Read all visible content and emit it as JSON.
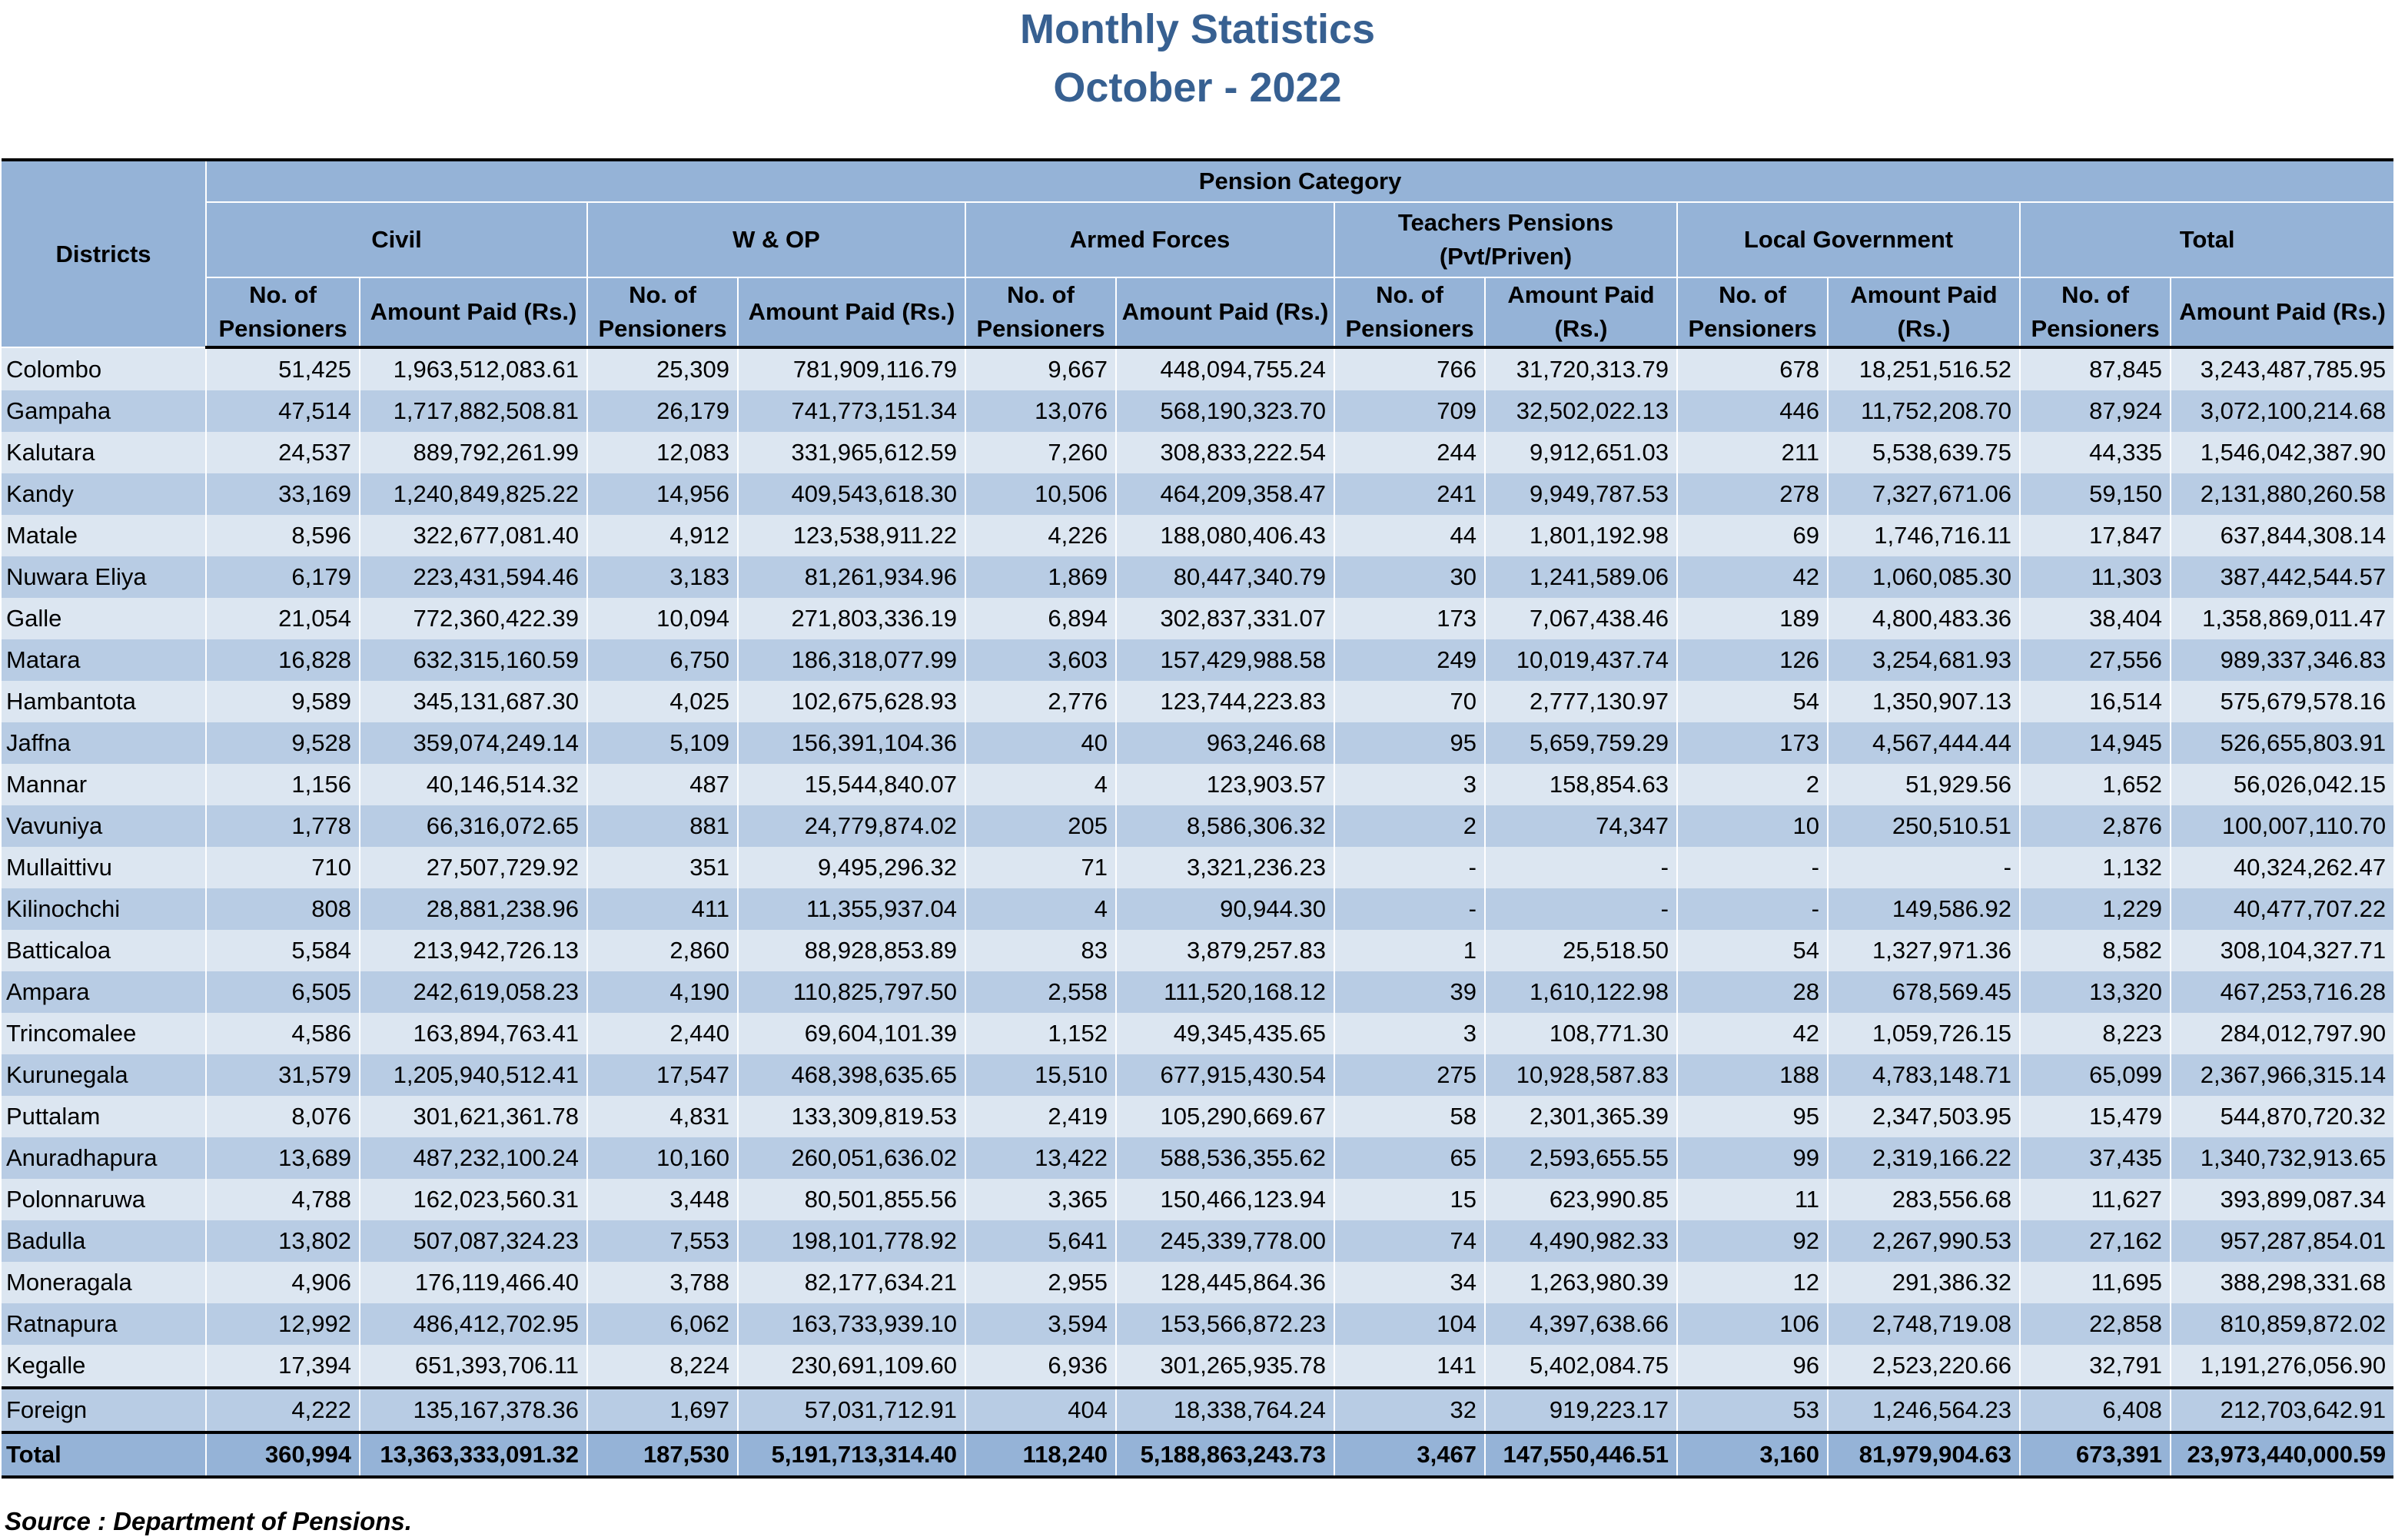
{
  "title": "Monthly Statistics",
  "subtitle": "October - 2022",
  "header": {
    "districts": "Districts",
    "pension_category": "Pension Category",
    "categories": [
      {
        "label": "Civil"
      },
      {
        "label": "W & OP"
      },
      {
        "label": "Armed Forces"
      },
      {
        "label": "Teachers Pensions (Pvt/Priven)"
      },
      {
        "label": "Local Government"
      },
      {
        "label": "Total"
      }
    ],
    "subcols": [
      "No. of Pensioners",
      "Amount Paid   (Rs.)",
      "No. of Pensioners",
      "Amount Paid (Rs.)",
      "No. of Pensioners",
      "Amount Paid (Rs.)",
      "No. of Pensioners",
      "Amount Paid (Rs.)",
      "No. of Pensioners",
      "Amount Paid (Rs.)",
      "No. of Pensioners",
      "Amount Paid (Rs.)"
    ]
  },
  "rows": [
    [
      "Colombo",
      "51,425",
      "1,963,512,083.61",
      "25,309",
      "781,909,116.79",
      "9,667",
      "448,094,755.24",
      "766",
      "31,720,313.79",
      "678",
      "18,251,516.52",
      "87,845",
      "3,243,487,785.95"
    ],
    [
      "Gampaha",
      "47,514",
      "1,717,882,508.81",
      "26,179",
      "741,773,151.34",
      "13,076",
      "568,190,323.70",
      "709",
      "32,502,022.13",
      "446",
      "11,752,208.70",
      "87,924",
      "3,072,100,214.68"
    ],
    [
      "Kalutara",
      "24,537",
      "889,792,261.99",
      "12,083",
      "331,965,612.59",
      "7,260",
      "308,833,222.54",
      "244",
      "9,912,651.03",
      "211",
      "5,538,639.75",
      "44,335",
      "1,546,042,387.90"
    ],
    [
      "Kandy",
      "33,169",
      "1,240,849,825.22",
      "14,956",
      "409,543,618.30",
      "10,506",
      "464,209,358.47",
      "241",
      "9,949,787.53",
      "278",
      "7,327,671.06",
      "59,150",
      "2,131,880,260.58"
    ],
    [
      "Matale",
      "8,596",
      "322,677,081.40",
      "4,912",
      "123,538,911.22",
      "4,226",
      "188,080,406.43",
      "44",
      "1,801,192.98",
      "69",
      "1,746,716.11",
      "17,847",
      "637,844,308.14"
    ],
    [
      "Nuwara Eliya",
      "6,179",
      "223,431,594.46",
      "3,183",
      "81,261,934.96",
      "1,869",
      "80,447,340.79",
      "30",
      "1,241,589.06",
      "42",
      "1,060,085.30",
      "11,303",
      "387,442,544.57"
    ],
    [
      "Galle",
      "21,054",
      "772,360,422.39",
      "10,094",
      "271,803,336.19",
      "6,894",
      "302,837,331.07",
      "173",
      "7,067,438.46",
      "189",
      "4,800,483.36",
      "38,404",
      "1,358,869,011.47"
    ],
    [
      "Matara",
      "16,828",
      "632,315,160.59",
      "6,750",
      "186,318,077.99",
      "3,603",
      "157,429,988.58",
      "249",
      "10,019,437.74",
      "126",
      "3,254,681.93",
      "27,556",
      "989,337,346.83"
    ],
    [
      "Hambantota",
      "9,589",
      "345,131,687.30",
      "4,025",
      "102,675,628.93",
      "2,776",
      "123,744,223.83",
      "70",
      "2,777,130.97",
      "54",
      "1,350,907.13",
      "16,514",
      "575,679,578.16"
    ],
    [
      "Jaffna",
      "9,528",
      "359,074,249.14",
      "5,109",
      "156,391,104.36",
      "40",
      "963,246.68",
      "95",
      "5,659,759.29",
      "173",
      "4,567,444.44",
      "14,945",
      "526,655,803.91"
    ],
    [
      "Mannar",
      "1,156",
      "40,146,514.32",
      "487",
      "15,544,840.07",
      "4",
      "123,903.57",
      "3",
      "158,854.63",
      "2",
      "51,929.56",
      "1,652",
      "56,026,042.15"
    ],
    [
      "Vavuniya",
      "1,778",
      "66,316,072.65",
      "881",
      "24,779,874.02",
      "205",
      "8,586,306.32",
      "2",
      "74,347",
      "10",
      "250,510.51",
      "2,876",
      "100,007,110.70"
    ],
    [
      "Mullaittivu",
      "710",
      "27,507,729.92",
      "351",
      "9,495,296.32",
      "71",
      "3,321,236.23",
      "-",
      "-",
      "-",
      "-",
      "1,132",
      "40,324,262.47"
    ],
    [
      "Kilinochchi",
      "808",
      "28,881,238.96",
      "411",
      "11,355,937.04",
      "4",
      "90,944.30",
      "-",
      "-",
      "-",
      "149,586.92",
      "1,229",
      "40,477,707.22"
    ],
    [
      "Batticaloa",
      "5,584",
      "213,942,726.13",
      "2,860",
      "88,928,853.89",
      "83",
      "3,879,257.83",
      "1",
      "25,518.50",
      "54",
      "1,327,971.36",
      "8,582",
      "308,104,327.71"
    ],
    [
      "Ampara",
      "6,505",
      "242,619,058.23",
      "4,190",
      "110,825,797.50",
      "2,558",
      "111,520,168.12",
      "39",
      "1,610,122.98",
      "28",
      "678,569.45",
      "13,320",
      "467,253,716.28"
    ],
    [
      "Trincomalee",
      "4,586",
      "163,894,763.41",
      "2,440",
      "69,604,101.39",
      "1,152",
      "49,345,435.65",
      "3",
      "108,771.30",
      "42",
      "1,059,726.15",
      "8,223",
      "284,012,797.90"
    ],
    [
      "Kurunegala",
      "31,579",
      "1,205,940,512.41",
      "17,547",
      "468,398,635.65",
      "15,510",
      "677,915,430.54",
      "275",
      "10,928,587.83",
      "188",
      "4,783,148.71",
      "65,099",
      "2,367,966,315.14"
    ],
    [
      "Puttalam",
      "8,076",
      "301,621,361.78",
      "4,831",
      "133,309,819.53",
      "2,419",
      "105,290,669.67",
      "58",
      "2,301,365.39",
      "95",
      "2,347,503.95",
      "15,479",
      "544,870,720.32"
    ],
    [
      "Anuradhapura",
      "13,689",
      "487,232,100.24",
      "10,160",
      "260,051,636.02",
      "13,422",
      "588,536,355.62",
      "65",
      "2,593,655.55",
      "99",
      "2,319,166.22",
      "37,435",
      "1,340,732,913.65"
    ],
    [
      "Polonnaruwa",
      "4,788",
      "162,023,560.31",
      "3,448",
      "80,501,855.56",
      "3,365",
      "150,466,123.94",
      "15",
      "623,990.85",
      "11",
      "283,556.68",
      "11,627",
      "393,899,087.34"
    ],
    [
      "Badulla",
      "13,802",
      "507,087,324.23",
      "7,553",
      "198,101,778.92",
      "5,641",
      "245,339,778.00",
      "74",
      "4,490,982.33",
      "92",
      "2,267,990.53",
      "27,162",
      "957,287,854.01"
    ],
    [
      "Moneragala",
      "4,906",
      "176,119,466.40",
      "3,788",
      "82,177,634.21",
      "2,955",
      "128,445,864.36",
      "34",
      "1,263,980.39",
      "12",
      "291,386.32",
      "11,695",
      "388,298,331.68"
    ],
    [
      "Ratnapura",
      "12,992",
      "486,412,702.95",
      "6,062",
      "163,733,939.10",
      "3,594",
      "153,566,872.23",
      "104",
      "4,397,638.66",
      "106",
      "2,748,719.08",
      "22,858",
      "810,859,872.02"
    ],
    [
      "Kegalle",
      "17,394",
      "651,393,706.11",
      "8,224",
      "230,691,109.60",
      "6,936",
      "301,265,935.78",
      "141",
      "5,402,084.75",
      "96",
      "2,523,220.66",
      "32,791",
      "1,191,276,056.90"
    ]
  ],
  "foreign": [
    "Foreign",
    "4,222",
    "135,167,378.36",
    "1,697",
    "57,031,712.91",
    "404",
    "18,338,764.24",
    "32",
    "919,223.17",
    "53",
    "1,246,564.23",
    "6,408",
    "212,703,642.91"
  ],
  "total": [
    "Total",
    "360,994",
    "13,363,333,091.32",
    "187,530",
    "5,191,713,314.40",
    "118,240",
    "5,188,863,243.73",
    "3,467",
    "147,550,446.51",
    "3,160",
    "81,979,904.63",
    "673,391",
    "23,973,440,000.59"
  ],
  "source": "Source : Department of Pensions.",
  "colors": {
    "title": "#376091",
    "header_bg": "#95b3d7",
    "row_light": "#dce6f1",
    "row_dark": "#b8cce4",
    "total_bg": "#95b3d7"
  }
}
